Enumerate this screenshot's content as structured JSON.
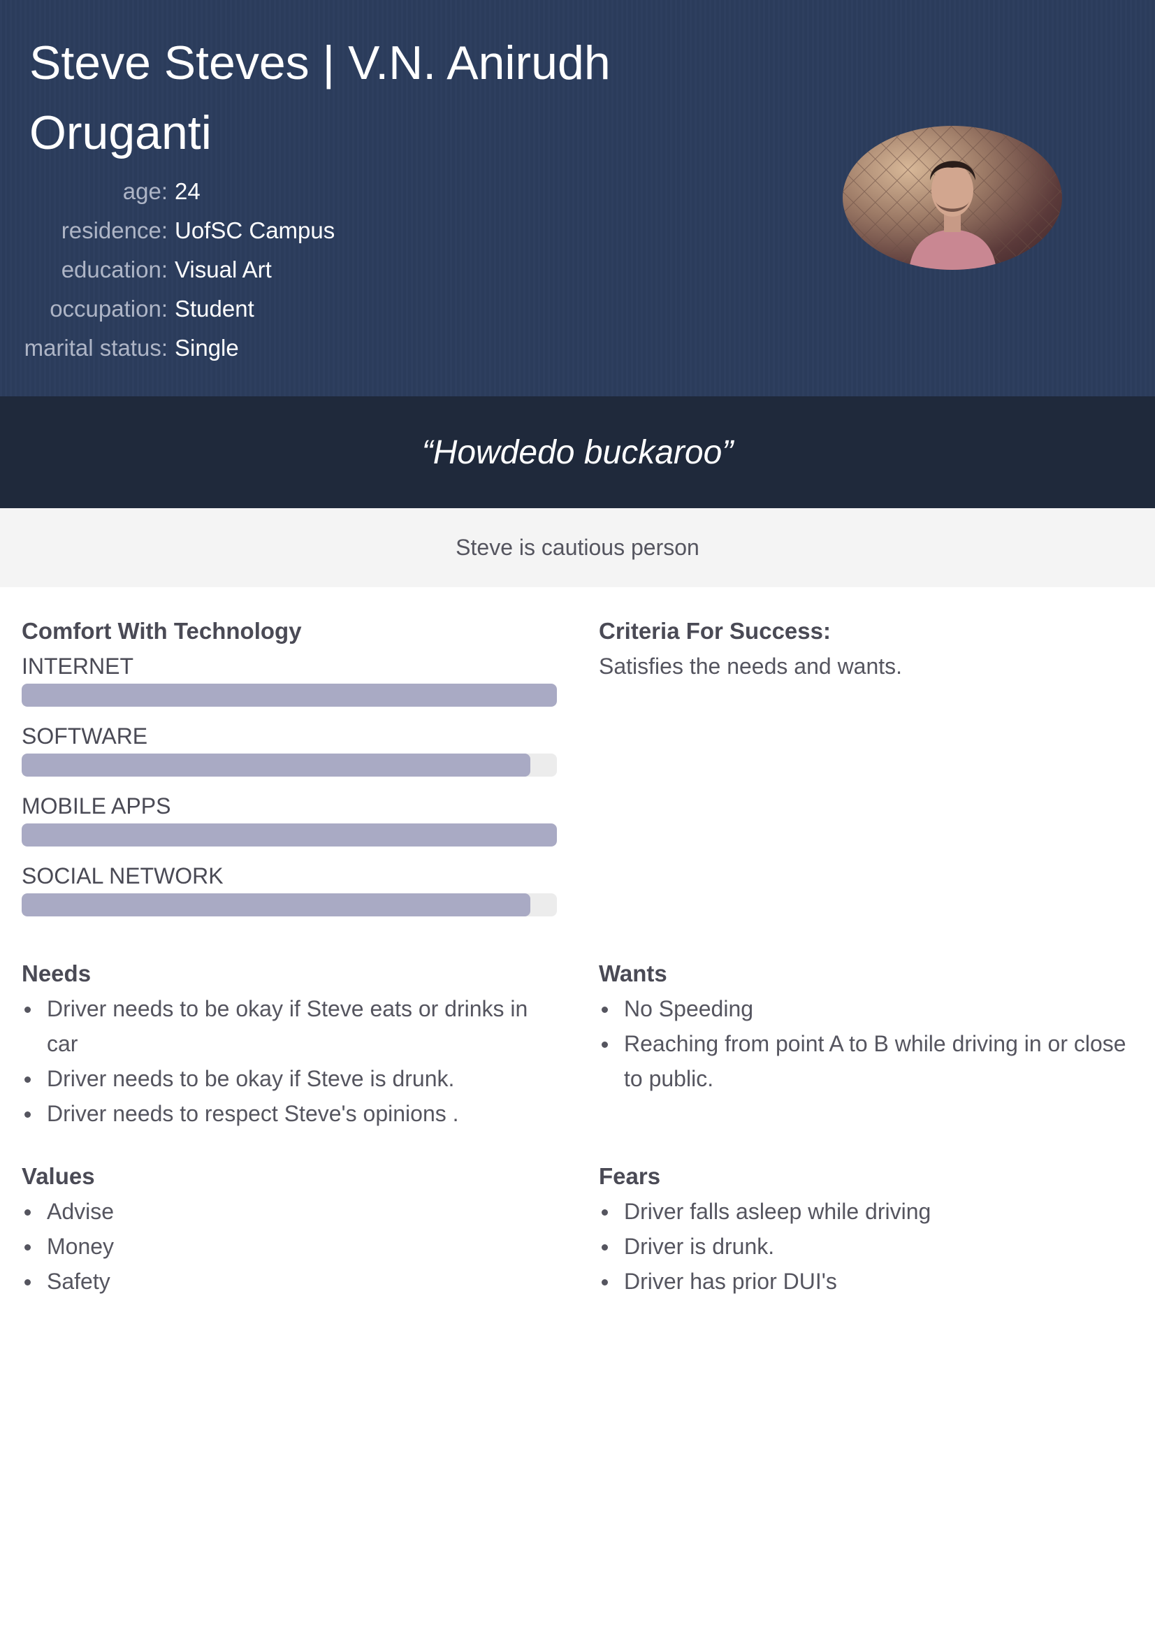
{
  "persona": {
    "name": "Steve Steves | V.N. Anirudh Oruganti",
    "facts": [
      {
        "label": "age:",
        "value": "24"
      },
      {
        "label": "residence:",
        "value": "UofSC Campus"
      },
      {
        "label": "education:",
        "value": "Visual Art"
      },
      {
        "label": "occupation:",
        "value": "Student"
      },
      {
        "label": "marital status:",
        "value": "Single"
      }
    ],
    "quote": "“Howdedo buckaroo”",
    "summary": "Steve is cautious person"
  },
  "technology": {
    "title": "Comfort With Technology",
    "skills": [
      {
        "label": "INTERNET",
        "level": 1.0
      },
      {
        "label": "SOFTWARE",
        "level": 0.95
      },
      {
        "label": "MOBILE APPS",
        "level": 1.0
      },
      {
        "label": "SOCIAL NETWORK",
        "level": 0.95
      }
    ]
  },
  "criteria": {
    "title": "Criteria For Success:",
    "text": "Satisfies the needs and wants."
  },
  "needs": {
    "title": "Needs",
    "items": [
      "Driver needs to be okay if Steve eats or drinks in car",
      "Driver needs to be okay if Steve is drunk.",
      "Driver needs to respect Steve's opinions ."
    ]
  },
  "wants": {
    "title": "Wants",
    "items": [
      "No Speeding",
      "Reaching from point A to B while driving in or close to public."
    ]
  },
  "values": {
    "title": "Values",
    "items": [
      "Advise",
      "Money",
      "Safety"
    ]
  },
  "fears": {
    "title": "Fears",
    "items": [
      "Driver falls asleep while driving",
      "Driver is drunk.",
      "Driver has prior DUI's"
    ]
  },
  "colors": {
    "header_bg": "#2c3d5d",
    "quote_bg": "#1f293b",
    "summary_bg": "#f4f4f4",
    "bar_fill": "#a9aac4",
    "bar_track": "#ececec"
  }
}
